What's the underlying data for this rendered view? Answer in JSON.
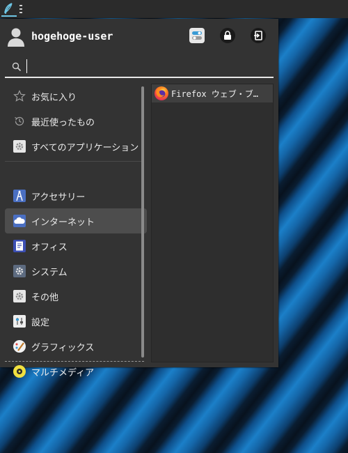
{
  "user": {
    "name": "hogehoge-user"
  },
  "search": {
    "value": "",
    "placeholder": ""
  },
  "categories": [
    {
      "label": "お気に入り",
      "icon": "star-icon"
    },
    {
      "label": "最近使ったもの",
      "icon": "history-icon"
    },
    {
      "label": "すべてのアプリケーション",
      "icon": "all-applications-icon"
    },
    {
      "label": "アクセサリー",
      "icon": "accessories-icon"
    },
    {
      "label": "インターネット",
      "icon": "internet-cloud-icon",
      "selected": true
    },
    {
      "label": "オフィス",
      "icon": "office-icon"
    },
    {
      "label": "システム",
      "icon": "system-icon"
    },
    {
      "label": "その他",
      "icon": "other-icon"
    },
    {
      "label": "設定",
      "icon": "settings-icon"
    },
    {
      "label": "グラフィックス",
      "icon": "graphics-icon"
    },
    {
      "label": "マルチメディア",
      "icon": "multimedia-icon"
    }
  ],
  "apps": [
    {
      "label": "Firefox ウェブ・ブ…",
      "icon": "firefox-icon"
    }
  ],
  "colors": {
    "menu_bg": "#333333",
    "selected_bg": "#4d4d4d",
    "accent": "#6ec7e6"
  }
}
